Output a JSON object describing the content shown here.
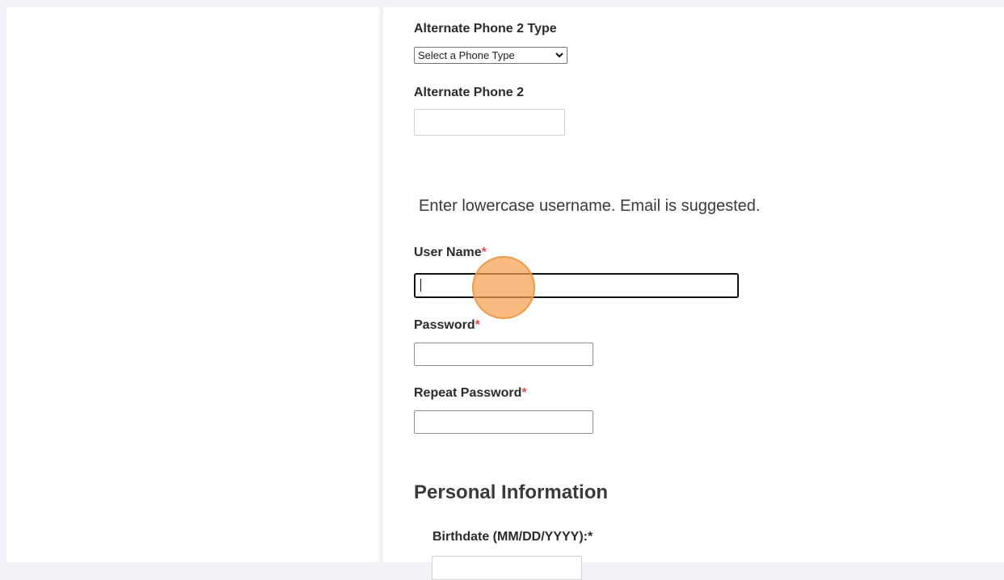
{
  "form": {
    "alt_phone2_type_label": "Alternate Phone 2 Type",
    "alt_phone2_type_select": "Select a Phone Type",
    "alt_phone2_label": "Alternate Phone 2",
    "username_hint": "Enter lowercase username.  Email is suggested.",
    "username_label": "User Name",
    "password_label": "Password",
    "repeat_password_label": "Repeat Password",
    "required_mark": "*"
  },
  "personal": {
    "heading": "Personal Information",
    "birthdate_label": "Birthdate (MM/DD/YYYY):*"
  },
  "icons": {
    "select_chevron": "chevron-down-icon"
  },
  "colors": {
    "required": "#d9534f",
    "click_indicator": "#f7a050",
    "page_bg": "#f1f3f8"
  }
}
